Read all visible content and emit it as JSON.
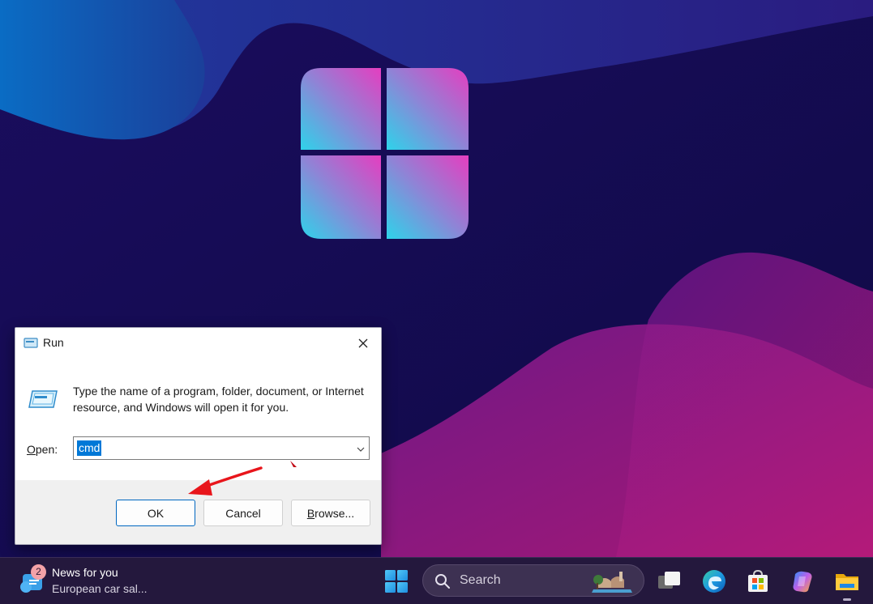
{
  "run_dialog": {
    "title": "Run",
    "description": "Type the name of a program, folder, document, or Internet resource, and Windows will open it for you.",
    "open_label_accel": "O",
    "open_label_rest": "pen:",
    "open_value": "cmd",
    "ok_label": "OK",
    "cancel_label": "Cancel",
    "browse_label_accel": "B",
    "browse_label_rest": "rowse..."
  },
  "taskbar": {
    "news_badge": "2",
    "news_title": "News for you",
    "news_subtitle": "European car sal...",
    "search_placeholder": "Search"
  },
  "icons": {
    "run_icon": "run-icon",
    "close": "close-icon",
    "dropdown": "chevron-down-icon",
    "start": "windows-start-icon",
    "search": "search-icon",
    "task_view": "task-view-icon",
    "edge": "edge-browser-icon",
    "store": "microsoft-store-icon",
    "copilot": "copilot-icon",
    "explorer": "file-explorer-icon"
  },
  "colors": {
    "selection": "#0078d7",
    "ok_border": "#0067c0",
    "annotation_arrow": "#e8151b",
    "taskbar": "#24183d"
  }
}
